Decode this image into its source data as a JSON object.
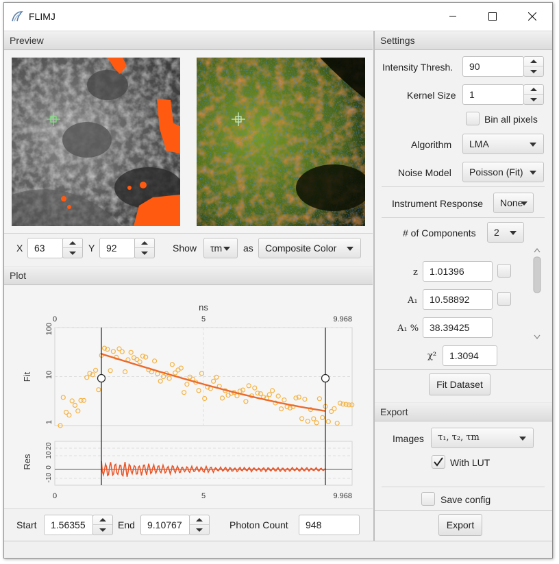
{
  "window": {
    "title": "FLIMJ"
  },
  "preview": {
    "header": "Preview",
    "x_label": "X",
    "x_value": "63",
    "y_label": "Y",
    "y_value": "92",
    "show_label": "Show",
    "show_value": "τm",
    "as_label": "as",
    "as_value": "Composite Color"
  },
  "plot": {
    "header": "Plot",
    "top_axis_title": "ns",
    "top_ticks": [
      "0",
      "5",
      "9.968"
    ],
    "bottom_ticks": [
      "0",
      "5",
      "9.968"
    ],
    "fit_label": "Fit",
    "fit_yticks": [
      "100",
      "10",
      "1"
    ],
    "res_label": "Res",
    "res_yticks": [
      "20",
      "10",
      "0",
      "-10"
    ],
    "colors": {
      "data": "#f5b342",
      "fit": "#ec6a2a",
      "residual": "#e8572a"
    }
  },
  "range": {
    "start_label": "Start",
    "start_value": "1.56355",
    "end_label": "End",
    "end_value": "9.10767",
    "photon_label": "Photon Count",
    "photon_value": "948"
  },
  "settings": {
    "header": "Settings",
    "intensity_label": "Intensity Thresh.",
    "intensity_value": "90",
    "kernel_label": "Kernel Size",
    "kernel_value": "1",
    "bin_all_label": "Bin all pixels",
    "algorithm_label": "Algorithm",
    "algorithm_value": "LMA",
    "noise_label": "Noise Model",
    "noise_value": "Poisson (Fit)",
    "irf_label": "Instrument Response",
    "irf_value": "None",
    "components_label": "# of Components",
    "components_value": "2",
    "params": [
      {
        "label": "z",
        "value": "1.01396"
      },
      {
        "label": "A₁",
        "value": "10.58892"
      },
      {
        "label": "A₁ %",
        "value": "38.39425"
      }
    ],
    "chi2_label": "χ²",
    "chi2_value": "1.3094",
    "fit_dataset_label": "Fit Dataset"
  },
  "export": {
    "header": "Export",
    "images_label": "Images",
    "images_value": "τ₁, τ₂, τm",
    "with_lut_label": "With LUT",
    "save_config_label": "Save config",
    "export_label": "Export"
  }
}
